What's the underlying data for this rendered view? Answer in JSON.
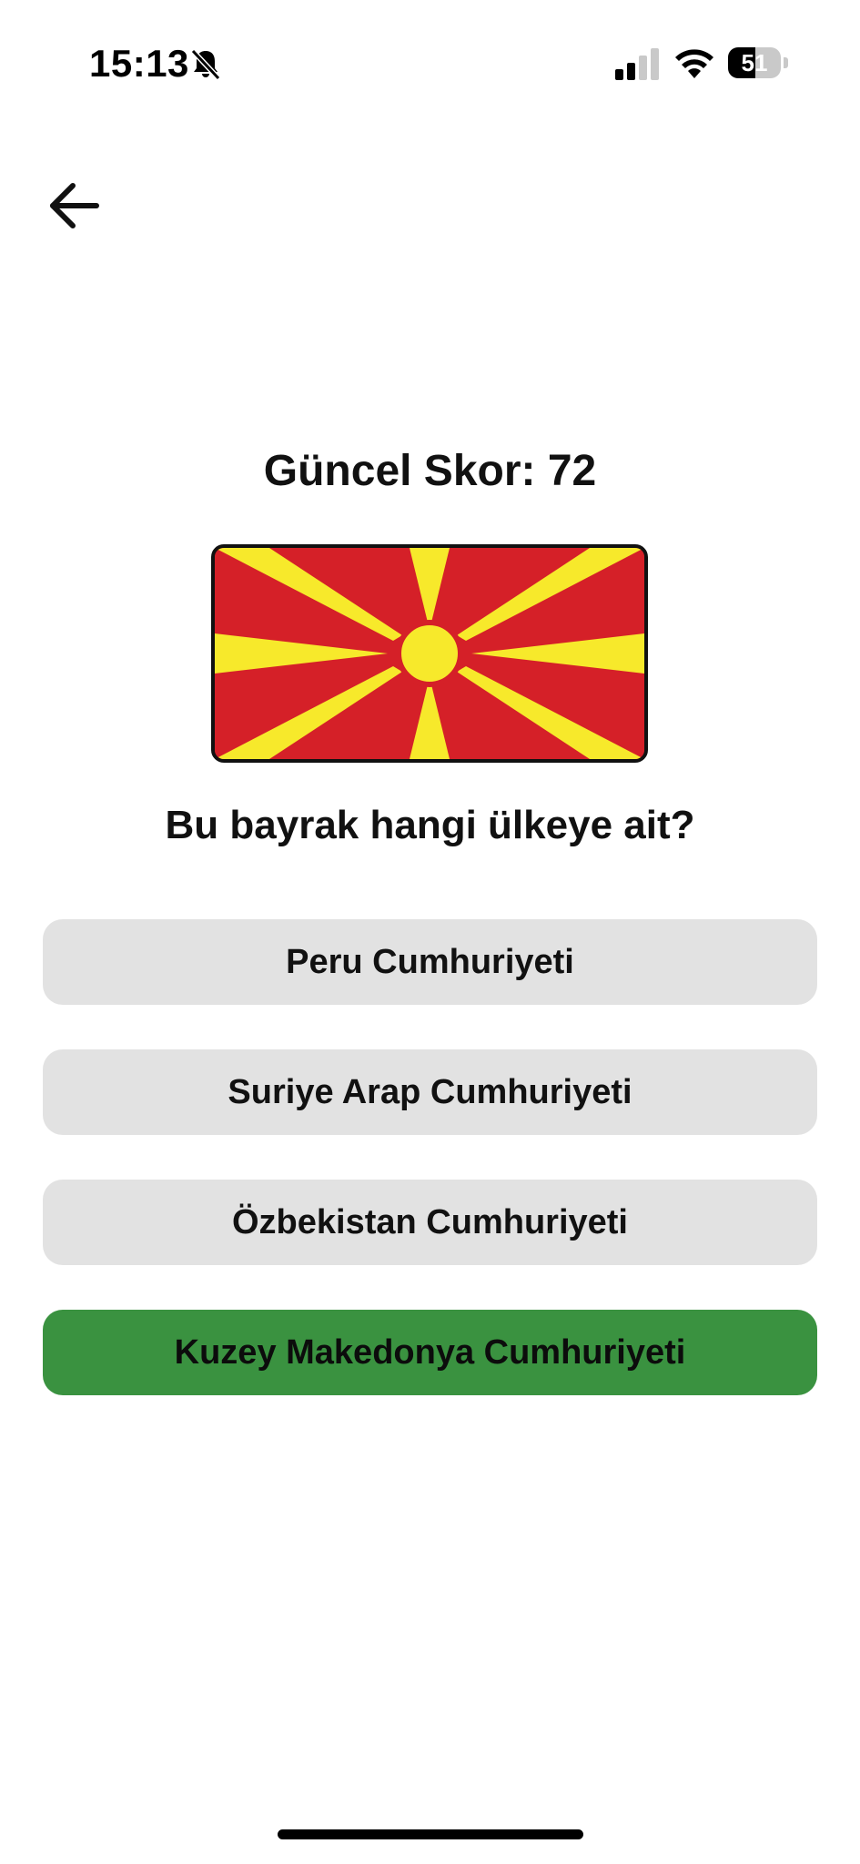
{
  "status_bar": {
    "time": "15:13",
    "battery_level": "51",
    "icons": [
      "bell-slash-icon",
      "signal-icon",
      "wifi-icon",
      "battery-icon"
    ]
  },
  "navigation": {
    "back_icon": "arrow-left-icon"
  },
  "quiz": {
    "score_label": "Güncel Skor: 72",
    "flag": {
      "name": "north-macedonia-flag",
      "colors": {
        "field": "#d52028",
        "sun": "#f7e92b"
      }
    },
    "question": "Bu bayrak hangi ülkeye ait?",
    "options": [
      {
        "label": "Peru Cumhuriyeti",
        "state": "default"
      },
      {
        "label": "Suriye Arap Cumhuriyeti",
        "state": "default"
      },
      {
        "label": "Özbekistan Cumhuriyeti",
        "state": "default"
      },
      {
        "label": "Kuzey Makedonya Cumhuriyeti",
        "state": "correct"
      }
    ]
  },
  "colors": {
    "option_default": "#e2e2e2",
    "option_correct": "#3a9240",
    "text": "#111111"
  }
}
